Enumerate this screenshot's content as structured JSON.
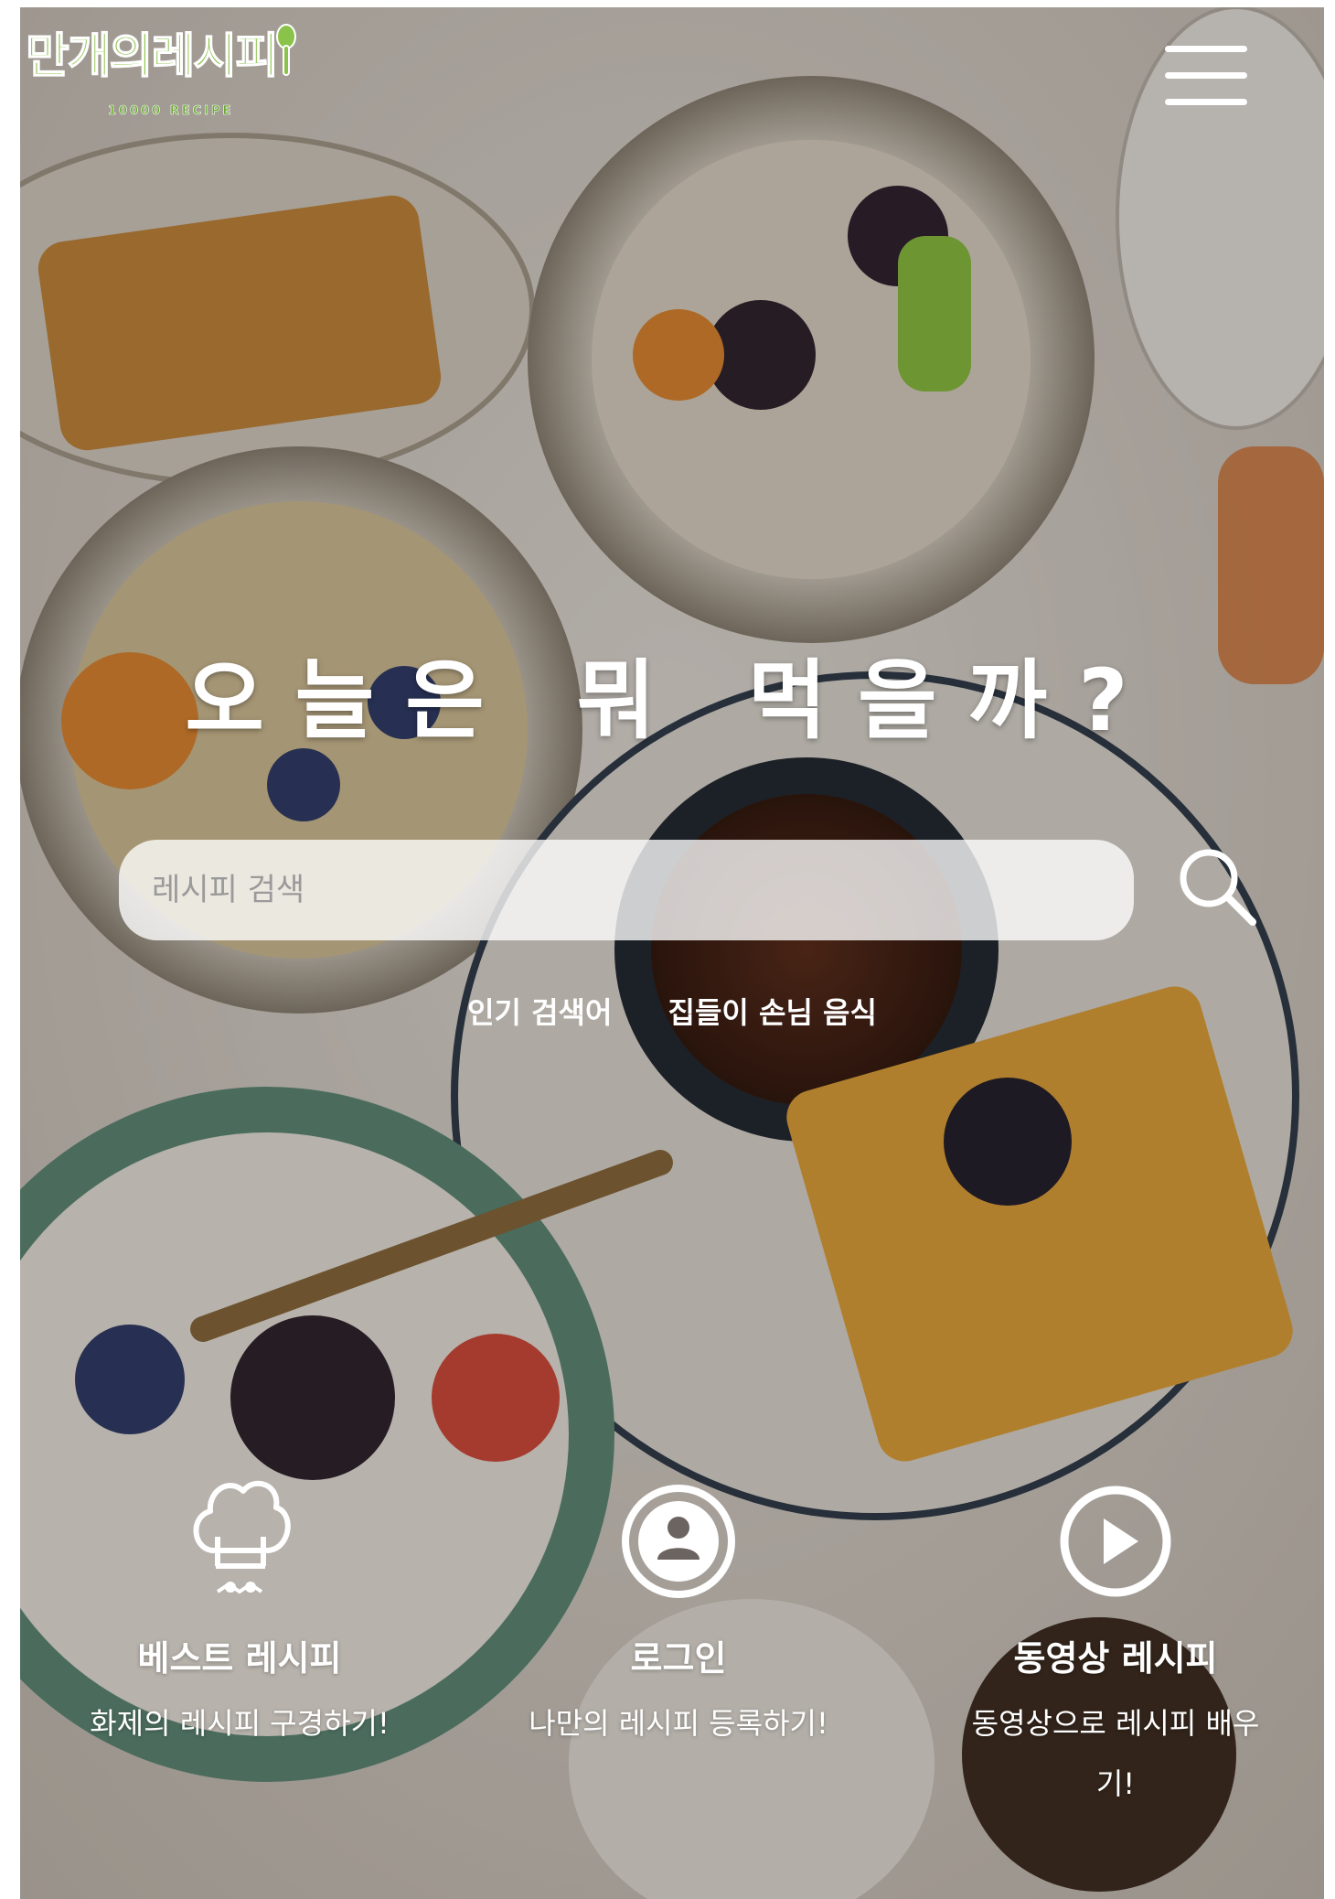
{
  "header": {
    "logo_text": "만개의레시피",
    "logo_subtext": "10000 RECIPE",
    "menu_icon": "hamburger-menu-icon"
  },
  "hero": {
    "headline": "오늘은 뭐 먹을까?"
  },
  "search": {
    "placeholder": "레시피 검색",
    "value": "",
    "button_icon": "search-icon"
  },
  "popular": {
    "label": "인기 검색어",
    "keyword": "집들이 손님 음식"
  },
  "features": [
    {
      "icon": "chef-hat-icon",
      "title": "베스트 레시피",
      "description": "화제의 레시피 구경하기!"
    },
    {
      "icon": "user-circle-icon",
      "title": "로그인",
      "description": "나만의 레시피 등록하기!"
    },
    {
      "icon": "play-circle-icon",
      "title": "동영상 레시피",
      "description": "동영상으로 레시피 배우기!"
    }
  ],
  "colors": {
    "brand_green": "#8bc34a",
    "overlay_text": "#ffffff"
  }
}
